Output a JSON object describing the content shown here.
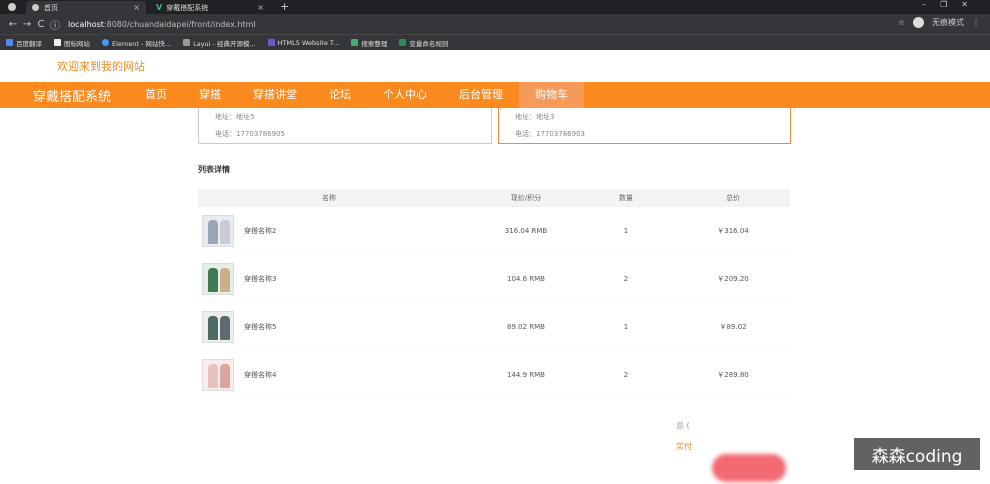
{
  "browser": {
    "tabs": [
      {
        "label": "首页"
      },
      {
        "label": "穿戴搭配系统"
      }
    ],
    "url_host": "localhost",
    "url_rest": ":8080/chuandaidapei/front/index.html",
    "profile_label": "无痕模式",
    "bookmarks": [
      "百度翻译",
      "图标网站",
      "Element - 网站快...",
      "Layui - 经典开源模...",
      "HTML5 Website T...",
      "搜索整理",
      "变量命名规则"
    ]
  },
  "site": {
    "welcome": "欢迎来到我的网站",
    "brand": "穿戴搭配系统",
    "nav": [
      "首页",
      "穿搭",
      "穿搭讲堂",
      "论坛",
      "个人中心",
      "后台管理",
      "购物车"
    ],
    "active_nav": "购物车"
  },
  "addresses": [
    {
      "addr": "地址：地址5",
      "phone": "电话：17703786905"
    },
    {
      "addr": "地址：地址3",
      "phone": "电话：17703786903"
    }
  ],
  "list": {
    "title": "列表详情",
    "headers": {
      "name": "名称",
      "price": "现价/积分",
      "qty": "数量",
      "total": "总价"
    },
    "rows": [
      {
        "name": "穿搭名称2",
        "price": "316.04 RMB",
        "qty": "1",
        "total": "￥316.04"
      },
      {
        "name": "穿搭名称3",
        "price": "104.6 RMB",
        "qty": "2",
        "total": "￥209.20"
      },
      {
        "name": "穿搭名称5",
        "price": "89.02 RMB",
        "qty": "1",
        "total": "￥89.02"
      },
      {
        "name": "穿搭名称4",
        "price": "144.9 RMB",
        "qty": "2",
        "total": "￥289.80"
      }
    ]
  },
  "summary": {
    "total_label": "总 (",
    "pay_label": "实付"
  },
  "watermark": "森森coding",
  "colors": {
    "accent": "#fb8a1e",
    "active_nav": "#f59a58",
    "pay": "#f25a64"
  }
}
